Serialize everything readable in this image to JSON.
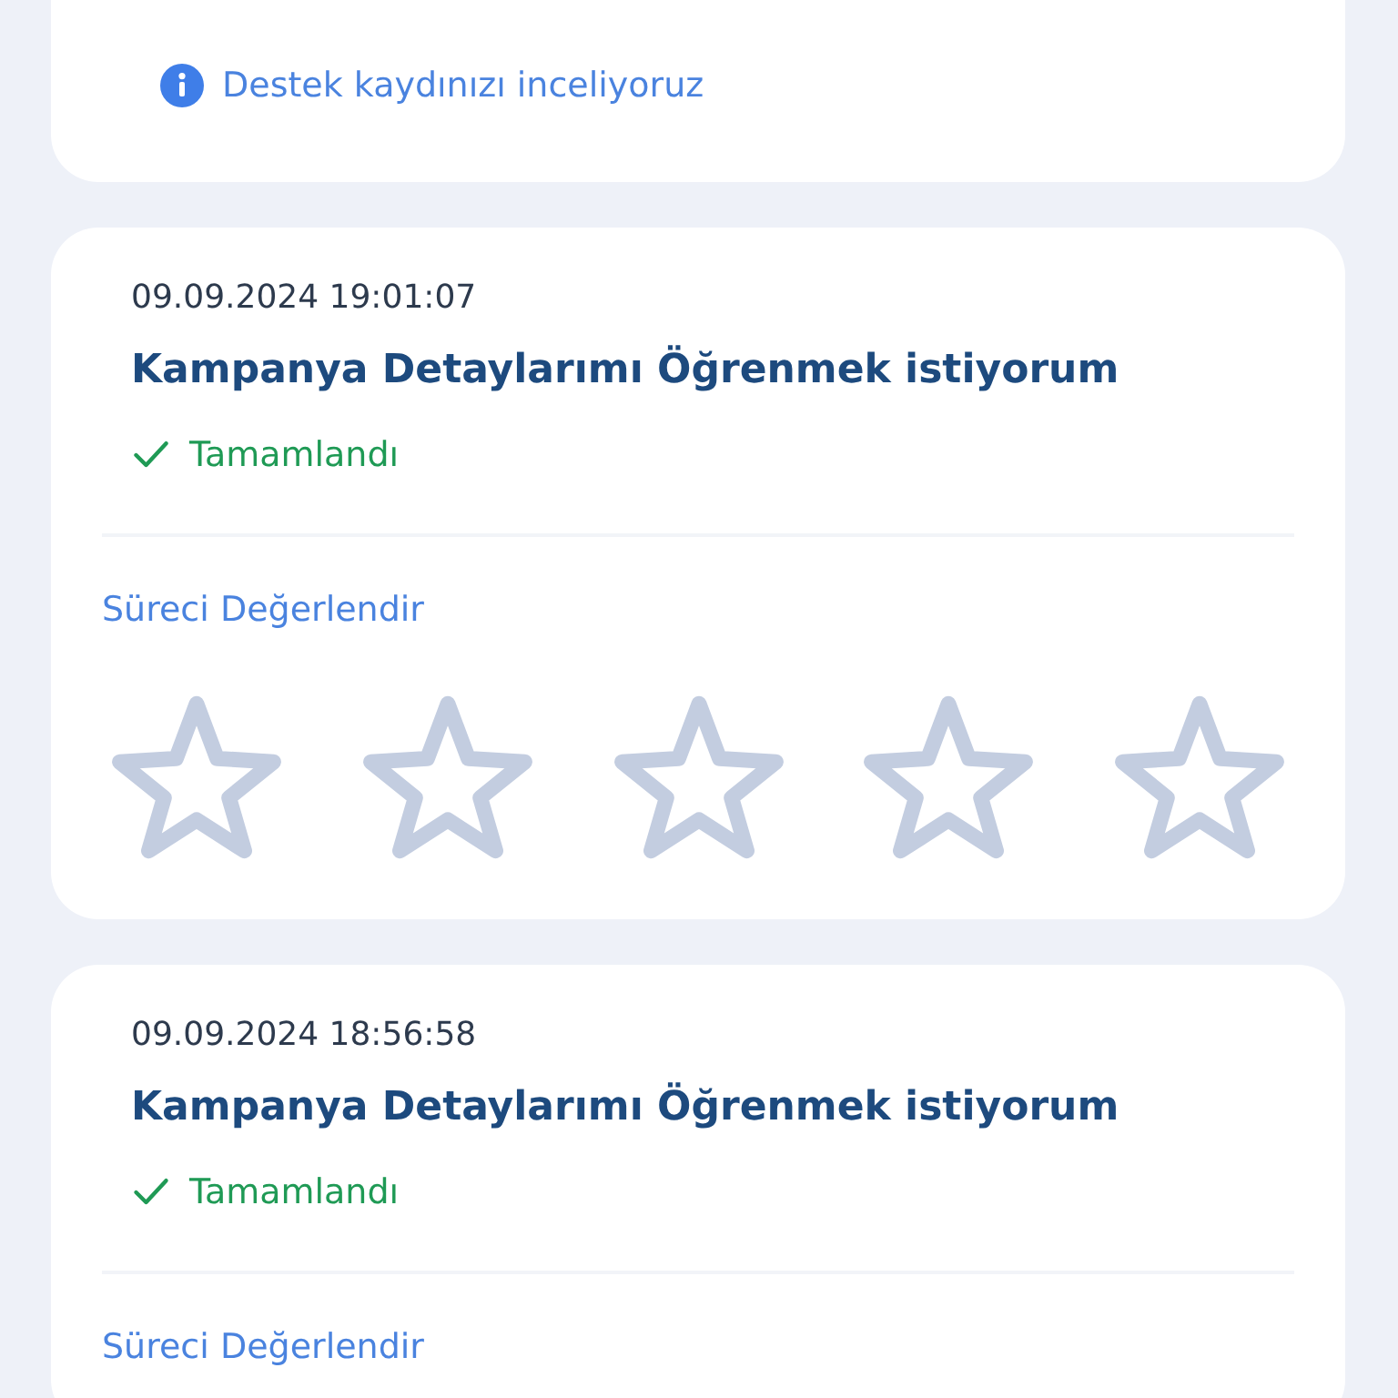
{
  "cards": [
    {
      "status": {
        "kind": "info",
        "text": "Destek kaydınızı inceliyoruz"
      }
    },
    {
      "date": "09.09.2024 19:01:07",
      "title": "Kampanya Detaylarımı Öğrenmek istiyorum",
      "status": {
        "kind": "completed",
        "text": "Tamamlandı"
      },
      "rating": {
        "label": "Süreci Değerlendir",
        "stars": 0
      }
    },
    {
      "date": "09.09.2024 18:56:58",
      "title": "Kampanya Detaylarımı Öğrenmek istiyorum",
      "status": {
        "kind": "completed",
        "text": "Tamamlandı"
      },
      "rating": {
        "label": "Süreci Değerlendir"
      }
    }
  ]
}
